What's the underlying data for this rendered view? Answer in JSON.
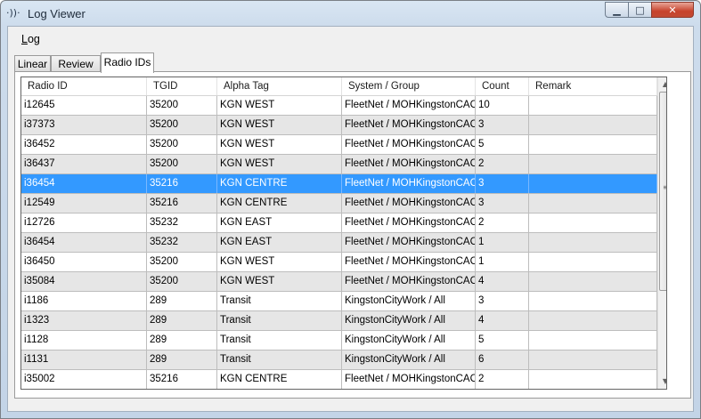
{
  "window": {
    "title": "Log Viewer",
    "icon_glyph": "·))·",
    "icon_name": "radio-signal-icon",
    "min_glyph": "▁",
    "max_glyph": "□",
    "close_glyph": "✕"
  },
  "menu": {
    "log_label_first": "L",
    "log_label_rest": "og"
  },
  "tabs": [
    {
      "label": "Linear"
    },
    {
      "label": "Review"
    },
    {
      "label": "Radio IDs",
      "selected": true
    }
  ],
  "table": {
    "columns": [
      "Radio ID",
      "TGID",
      "Alpha Tag",
      "System / Group",
      "Count",
      "Remark"
    ],
    "selected_row": 4,
    "rows": [
      [
        "i12645",
        "35200",
        "KGN WEST",
        "FleetNet / MOHKingstonCACC",
        "10",
        ""
      ],
      [
        "i37373",
        "35200",
        "KGN WEST",
        "FleetNet / MOHKingstonCACC",
        "3",
        ""
      ],
      [
        "i36452",
        "35200",
        "KGN WEST",
        "FleetNet / MOHKingstonCACC",
        "5",
        ""
      ],
      [
        "i36437",
        "35200",
        "KGN WEST",
        "FleetNet / MOHKingstonCACC",
        "2",
        ""
      ],
      [
        "i36454",
        "35216",
        "KGN CENTRE",
        "FleetNet / MOHKingstonCACC",
        "3",
        ""
      ],
      [
        "i12549",
        "35216",
        "KGN CENTRE",
        "FleetNet / MOHKingstonCACC",
        "3",
        ""
      ],
      [
        "i12726",
        "35232",
        "KGN EAST",
        "FleetNet / MOHKingstonCACC",
        "2",
        ""
      ],
      [
        "i36454",
        "35232",
        "KGN EAST",
        "FleetNet / MOHKingstonCACC",
        "1",
        ""
      ],
      [
        "i36450",
        "35200",
        "KGN WEST",
        "FleetNet / MOHKingstonCACC",
        "1",
        ""
      ],
      [
        "i35084",
        "35200",
        "KGN WEST",
        "FleetNet / MOHKingstonCACC",
        "4",
        ""
      ],
      [
        "i1186",
        "289",
        "Transit",
        "KingstonCityWork / All",
        "3",
        ""
      ],
      [
        "i1323",
        "289",
        "Transit",
        "KingstonCityWork / All",
        "4",
        ""
      ],
      [
        "i1128",
        "289",
        "Transit",
        "KingstonCityWork / All",
        "5",
        ""
      ],
      [
        "i1131",
        "289",
        "Transit",
        "KingstonCityWork / All",
        "6",
        ""
      ],
      [
        "i35002",
        "35216",
        "KGN CENTRE",
        "FleetNet / MOHKingstonCACC",
        "2",
        ""
      ]
    ]
  },
  "scrollbar": {
    "up_glyph": "▲",
    "down_glyph": "▼",
    "grip_glyph": "≡",
    "position_fraction": 0.0,
    "visible_fraction": 0.68
  },
  "colors": {
    "selection": "#3399ff",
    "alt_row": "#e6e6e6",
    "close_button": "#c7432c"
  }
}
